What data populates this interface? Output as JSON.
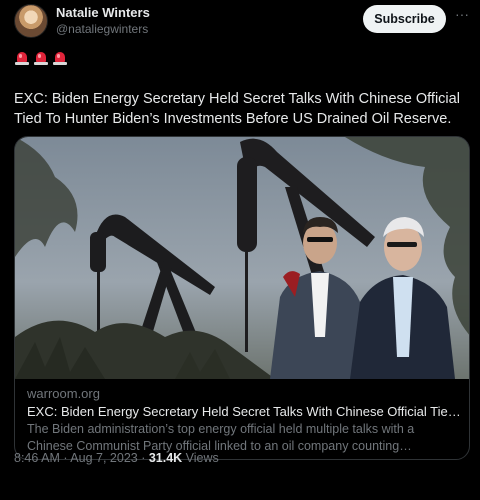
{
  "author": {
    "name": "Natalie Winters",
    "handle": "@nataliegwinters"
  },
  "actions": {
    "subscribe_label": "Subscribe",
    "more_label": "···"
  },
  "emoji": [
    "police-car-light",
    "police-car-light",
    "police-car-light"
  ],
  "tweet": {
    "text": "EXC: Biden Energy Secretary Held Secret Talks With Chinese Official Tied To Hunter Biden’s Investments Before US Drained Oil Reserve."
  },
  "card": {
    "domain": "warroom.org",
    "title": "EXC: Biden Energy Secretary Held Secret Talks With Chinese Official Tied To Hunter Biden’s Investments Before US Drained Oil Reserve.",
    "description": "The Biden administration’s top energy official held multiple talks with a Chinese Communist Party official linked to an oil company counting investment from Hunter Biden."
  },
  "footer": {
    "time": "8:46 AM",
    "separator": " · ",
    "date": "Aug 7, 2023",
    "views_count": "31.4K",
    "views_label": " Views"
  },
  "colors": {
    "background": "#000000",
    "text": "#e7e9ea",
    "muted": "#71767b",
    "border": "#2f3336",
    "siren": "#e0243a"
  }
}
